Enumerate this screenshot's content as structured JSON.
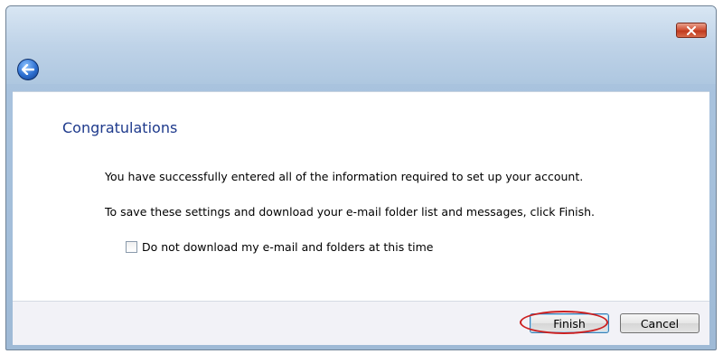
{
  "window": {
    "close_glyph": "✕"
  },
  "content": {
    "heading": "Congratulations",
    "message_line1": "You have successfully entered all of the information required to set up your account.",
    "message_line2": "To save these settings and download your e-mail folder list and messages, click Finish.",
    "checkbox_label": "Do not download my e-mail and folders at this time",
    "checkbox_checked": false
  },
  "footer": {
    "finish_label": "Finish",
    "cancel_label": "Cancel"
  },
  "colors": {
    "heading": "#1e3a8c",
    "close_button": "#c03a1f",
    "highlight": "#cc1f1f",
    "back_button": "#2d6fd0"
  },
  "icons": {
    "close": "close-icon",
    "back": "back-arrow-icon"
  }
}
